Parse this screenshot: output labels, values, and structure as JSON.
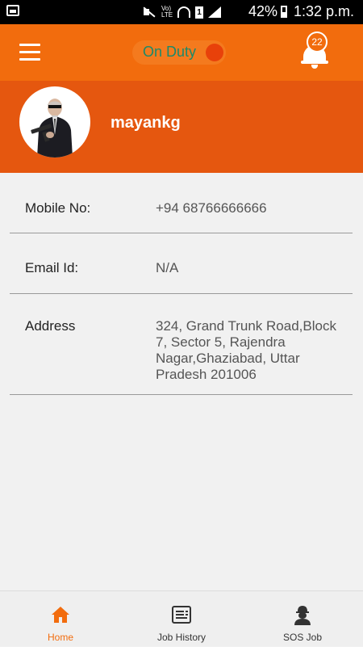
{
  "status_bar": {
    "battery": "42%",
    "time": "1:32 p.m.",
    "sim_slot": "1",
    "network": "LTE"
  },
  "toolbar": {
    "duty_label": "On Duty",
    "notification_count": "22"
  },
  "profile": {
    "username": "mayankg"
  },
  "details": {
    "mobile_label": "Mobile No:",
    "mobile_value": "+94  68766666666",
    "email_label": "Email Id:",
    "email_value": "N/A",
    "address_label": "Address",
    "address_value": "324, Grand Trunk Road,Block 7, Sector 5, Rajendra Nagar,Ghaziabad, Uttar Pradesh 201006"
  },
  "bottom_nav": {
    "items": [
      {
        "label": "Home",
        "icon": "home-icon"
      },
      {
        "label": "Job History",
        "icon": "job-history-icon"
      },
      {
        "label": "SOS Job",
        "icon": "sos-job-icon"
      }
    ]
  },
  "colors": {
    "primary": "#f26c0d",
    "header": "#e5570f",
    "toggle_text": "#1b8a6a"
  }
}
